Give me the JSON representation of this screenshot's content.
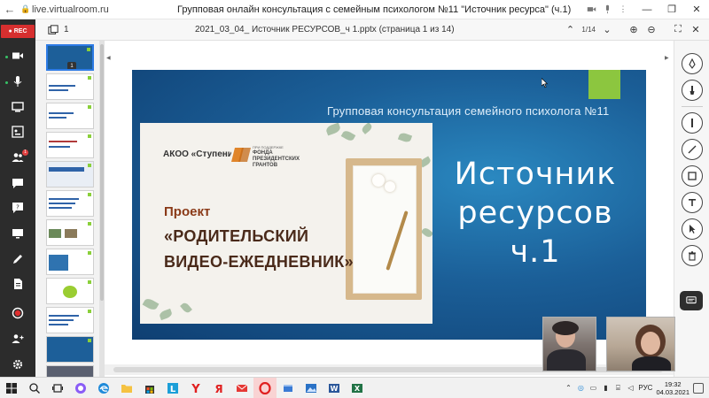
{
  "browser": {
    "url": "live.virtualroom.ru",
    "title": "Групповая онлайн консультация с семейным психологом №11 \"Источник ресурса\" (ч.1)"
  },
  "sidebar": {
    "rec_label": "REC",
    "badge_count": "1"
  },
  "doc_header": {
    "pages_count": "1",
    "file_name": "2021_03_04_ Источник РЕСУРСОВ_ч 1.pptx (страница 1 из 14)",
    "page_counter": "1/14"
  },
  "thumbnails": {
    "active_num": "1"
  },
  "slide": {
    "subtitle": "Групповая консультация семейного психолога №11",
    "title_line1": "Источник",
    "title_line2": "ресурсов",
    "title_line3": "ч.1",
    "org": "АКОО «Ступени»",
    "fund_support": "ПРИ ПОДДЕРЖКЕ",
    "fund_name": "ФОНДА ПРЕЗИДЕНТСКИХ ГРАНТОВ",
    "project_label": "Проект",
    "project_name_line1": "«РОДИТЕЛЬСКИЙ",
    "project_name_line2": "ВИДЕО-ЕЖЕДНЕВНИК»"
  },
  "taskbar": {
    "language": "РУС",
    "time": "19:32",
    "date": "04.03.2021"
  },
  "colors": {
    "rec": "#d72f2f",
    "sidebar": "#2c2c2c",
    "slide_blue": "#1b5f98",
    "accent_green": "#8cc63f"
  }
}
